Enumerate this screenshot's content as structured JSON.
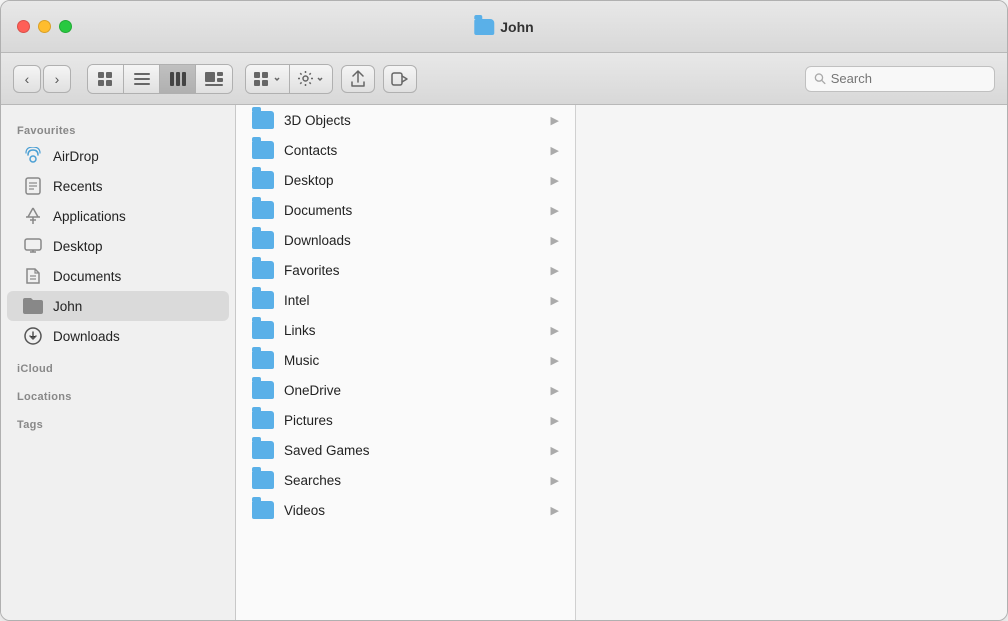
{
  "window": {
    "title": "John"
  },
  "toolbar": {
    "back_label": "‹",
    "forward_label": "›",
    "view_icons_label": "⊞",
    "view_list_label": "☰",
    "view_columns_label": "⦿",
    "view_gallery_label": "⊟",
    "group_label": "⊞",
    "action_label": "⚙",
    "share_label": "↑",
    "tag_label": "⬡",
    "search_placeholder": "Search"
  },
  "sidebar": {
    "favourites_header": "Favourites",
    "icloud_header": "iCloud",
    "locations_header": "Locations",
    "tags_header": "Tags",
    "items": [
      {
        "id": "airdrop",
        "label": "AirDrop",
        "icon": "airdrop"
      },
      {
        "id": "recents",
        "label": "Recents",
        "icon": "recents"
      },
      {
        "id": "applications",
        "label": "Applications",
        "icon": "applications"
      },
      {
        "id": "desktop",
        "label": "Desktop",
        "icon": "desktop"
      },
      {
        "id": "documents",
        "label": "Documents",
        "icon": "documents"
      },
      {
        "id": "john",
        "label": "John",
        "icon": "john",
        "active": true
      },
      {
        "id": "downloads",
        "label": "Downloads",
        "icon": "downloads"
      }
    ]
  },
  "files": [
    {
      "name": "3D Objects",
      "has_children": true
    },
    {
      "name": "Contacts",
      "has_children": true
    },
    {
      "name": "Desktop",
      "has_children": true
    },
    {
      "name": "Documents",
      "has_children": true
    },
    {
      "name": "Downloads",
      "has_children": true
    },
    {
      "name": "Favorites",
      "has_children": true
    },
    {
      "name": "Intel",
      "has_children": true
    },
    {
      "name": "Links",
      "has_children": true
    },
    {
      "name": "Music",
      "has_children": true
    },
    {
      "name": "OneDrive",
      "has_children": true
    },
    {
      "name": "Pictures",
      "has_children": true
    },
    {
      "name": "Saved Games",
      "has_children": true
    },
    {
      "name": "Searches",
      "has_children": true
    },
    {
      "name": "Videos",
      "has_children": true
    }
  ],
  "colors": {
    "accent": "#5ab0e8",
    "sidebar_bg": "#f0f0f0",
    "toolbar_bg": "#e0e0e0"
  }
}
